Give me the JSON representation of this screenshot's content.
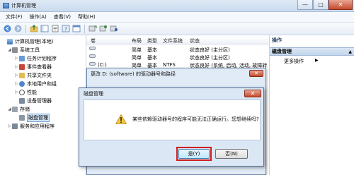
{
  "window": {
    "title": "计算机管理"
  },
  "window_controls": {
    "minimize": "—",
    "maximize": "□",
    "close": "✕"
  },
  "menu": [
    "文件(F)",
    "操作(A)",
    "查看(V)",
    "帮助(H)"
  ],
  "toolbar_icons": [
    "back-icon",
    "forward-icon",
    "up-folder-icon",
    "show-tree-icon",
    "properties-icon",
    "help-icon",
    "console-icon",
    "refresh-icon",
    "export-icon",
    "settings-icon"
  ],
  "tree": [
    {
      "label": "计算机管理(本地)",
      "level": 0,
      "icon": "computer-icon",
      "toggle": ""
    },
    {
      "label": "系统工具",
      "level": 1,
      "icon": "tools-icon",
      "toggle": "◢"
    },
    {
      "label": "任务计划程序",
      "level": 2,
      "icon": "task-scheduler-icon",
      "toggle": "▷"
    },
    {
      "label": "事件查看器",
      "level": 2,
      "icon": "event-viewer-icon",
      "toggle": "▷"
    },
    {
      "label": "共享文件夹",
      "level": 2,
      "icon": "shared-folder-icon",
      "toggle": "▷"
    },
    {
      "label": "本地用户和组",
      "level": 2,
      "icon": "users-icon",
      "toggle": "▷"
    },
    {
      "label": "性能",
      "level": 2,
      "icon": "performance-icon",
      "toggle": "▷"
    },
    {
      "label": "设备管理器",
      "level": 2,
      "icon": "device-manager-icon",
      "toggle": ""
    },
    {
      "label": "存储",
      "level": 1,
      "icon": "storage-icon",
      "toggle": "◢"
    },
    {
      "label": "磁盘管理",
      "level": 2,
      "icon": "disk-management-icon",
      "toggle": "",
      "selected": true
    },
    {
      "label": "服务和应用程序",
      "level": 1,
      "icon": "services-icon",
      "toggle": "▷"
    }
  ],
  "volume_table": {
    "headers": [
      "卷",
      "布局",
      "类型",
      "文件系统",
      "状态"
    ],
    "rows": [
      {
        "vol": "",
        "layout": "简单",
        "type": "基本",
        "fs": "",
        "status": "状态良好 (主分区)"
      },
      {
        "vol": "",
        "layout": "简单",
        "type": "基本",
        "fs": "",
        "status": "状态良好 (主分区)"
      },
      {
        "vol": "(C:)",
        "layout": "简单",
        "type": "基本",
        "fs": "NTFS",
        "status": "状态良好 (系统, 启动, 活动, 故障转"
      }
    ]
  },
  "actions": {
    "header": "操作",
    "section": "磁盘管理",
    "items": [
      "更多操作"
    ]
  },
  "dialog_drive_letter": {
    "title": "更改 D: (software) 的驱动器号和路径"
  },
  "dialog_confirm": {
    "title": "磁盘管理",
    "message": "某些依赖驱动器号的程序可能无法正确运行。您想继续吗?",
    "yes_label": "是(Y)",
    "no_label": "否(N)",
    "close_label": "✕"
  }
}
